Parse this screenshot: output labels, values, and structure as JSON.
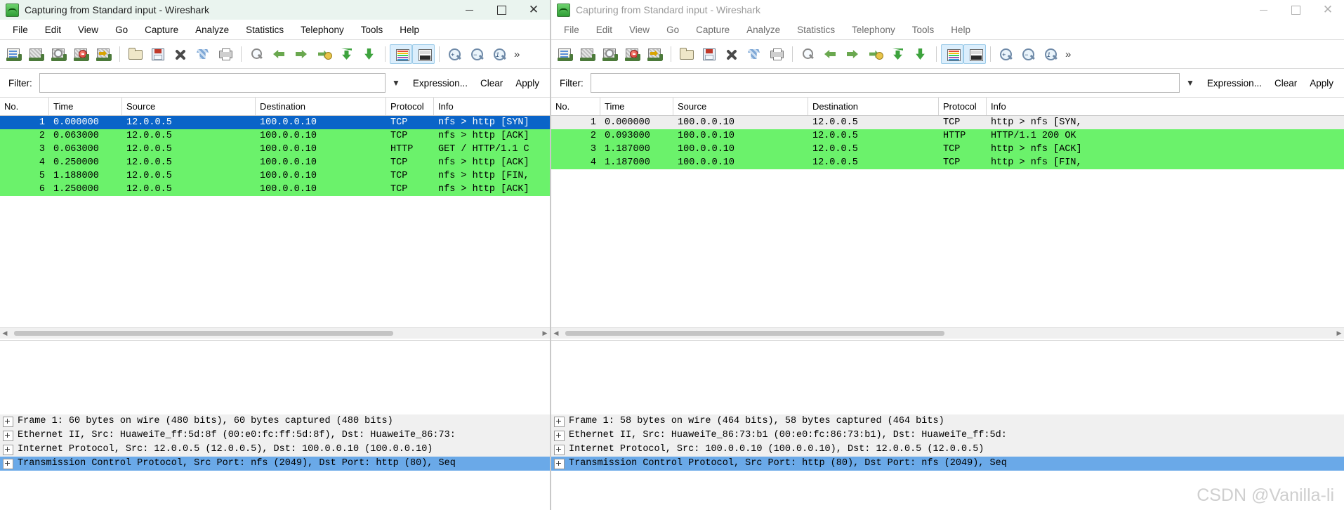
{
  "windows": [
    {
      "id": "left",
      "title": "Capturing from Standard input - Wireshark",
      "active": true,
      "window_buttons": {
        "minimize": "—",
        "maximize": "□",
        "close": "✕"
      },
      "menu": [
        "File",
        "Edit",
        "View",
        "Go",
        "Capture",
        "Analyze",
        "Statistics",
        "Telephony",
        "Tools",
        "Help"
      ],
      "toolbar_icons": [
        "interfaces-icon",
        "capture-options-icon",
        "start-capture-icon",
        "stop-capture-icon",
        "restart-capture-icon",
        "open-file-icon",
        "save-file-icon",
        "close-file-icon",
        "reload-icon",
        "print-icon",
        "find-packet-icon",
        "go-back-icon",
        "go-forward-icon",
        "go-to-packet-icon",
        "go-first-packet-icon",
        "go-last-packet-icon",
        "colorize-icon",
        "auto-scroll-icon",
        "zoom-in-icon",
        "zoom-out-icon",
        "zoom-reset-icon"
      ],
      "filter": {
        "label": "Filter:",
        "value": "",
        "placeholder": "",
        "dropdown": "▼",
        "expression": "Expression...",
        "clear": "Clear",
        "apply": "Apply"
      },
      "columns": [
        "No.",
        "Time",
        "Source",
        "Destination",
        "Protocol",
        "Info"
      ],
      "packets": [
        {
          "no": "1",
          "time": "0.000000",
          "source": "12.0.0.5",
          "destination": "100.0.0.10",
          "protocol": "TCP",
          "info": "nfs > http [SYN]",
          "state": "selected"
        },
        {
          "no": "2",
          "time": "0.063000",
          "source": "12.0.0.5",
          "destination": "100.0.0.10",
          "protocol": "TCP",
          "info": "nfs > http [ACK]",
          "state": "green"
        },
        {
          "no": "3",
          "time": "0.063000",
          "source": "12.0.0.5",
          "destination": "100.0.0.10",
          "protocol": "HTTP",
          "info": "GET / HTTP/1.1 C",
          "state": "green"
        },
        {
          "no": "4",
          "time": "0.250000",
          "source": "12.0.0.5",
          "destination": "100.0.0.10",
          "protocol": "TCP",
          "info": "nfs > http [ACK]",
          "state": "green"
        },
        {
          "no": "5",
          "time": "1.188000",
          "source": "12.0.0.5",
          "destination": "100.0.0.10",
          "protocol": "TCP",
          "info": "nfs > http [FIN,",
          "state": "green"
        },
        {
          "no": "6",
          "time": "1.250000",
          "source": "12.0.0.5",
          "destination": "100.0.0.10",
          "protocol": "TCP",
          "info": "nfs > http [ACK]",
          "state": "green"
        }
      ],
      "detail_rows": [
        {
          "text": "Frame 1: 60 bytes on wire (480 bits), 60 bytes captured (480 bits)",
          "selected": false
        },
        {
          "text": "Ethernet II, Src: HuaweiTe_ff:5d:8f (00:e0:fc:ff:5d:8f), Dst: HuaweiTe_86:73:",
          "selected": false
        },
        {
          "text": "Internet Protocol, Src: 12.0.0.5 (12.0.0.5), Dst: 100.0.0.10 (100.0.0.10)",
          "selected": false
        },
        {
          "text": "Transmission Control Protocol, Src Port: nfs (2049), Dst Port: http (80), Seq",
          "selected": true
        }
      ]
    },
    {
      "id": "right",
      "title": "Capturing from Standard input - Wireshark",
      "active": false,
      "window_buttons": {
        "minimize": "—",
        "maximize": "□",
        "close": "✕"
      },
      "menu": [
        "File",
        "Edit",
        "View",
        "Go",
        "Capture",
        "Analyze",
        "Statistics",
        "Telephony",
        "Tools",
        "Help"
      ],
      "toolbar_icons": [
        "interfaces-icon",
        "capture-options-icon",
        "start-capture-icon",
        "stop-capture-icon",
        "restart-capture-icon",
        "open-file-icon",
        "save-file-icon",
        "close-file-icon",
        "reload-icon",
        "print-icon",
        "find-packet-icon",
        "go-back-icon",
        "go-forward-icon",
        "go-to-packet-icon",
        "go-first-packet-icon",
        "go-last-packet-icon",
        "colorize-icon",
        "auto-scroll-icon",
        "zoom-in-icon",
        "zoom-out-icon",
        "zoom-reset-icon"
      ],
      "filter": {
        "label": "Filter:",
        "value": "",
        "placeholder": "",
        "dropdown": "▼",
        "expression": "Expression...",
        "clear": "Clear",
        "apply": "Apply"
      },
      "columns": [
        "No.",
        "Time",
        "Source",
        "Destination",
        "Protocol",
        "Info"
      ],
      "packets": [
        {
          "no": "1",
          "time": "0.000000",
          "source": "100.0.0.10",
          "destination": "12.0.0.5",
          "protocol": "TCP",
          "info": "http > nfs [SYN,",
          "state": "selected-inactive"
        },
        {
          "no": "2",
          "time": "0.093000",
          "source": "100.0.0.10",
          "destination": "12.0.0.5",
          "protocol": "HTTP",
          "info": "HTTP/1.1 200 OK",
          "state": "green"
        },
        {
          "no": "3",
          "time": "1.187000",
          "source": "100.0.0.10",
          "destination": "12.0.0.5",
          "protocol": "TCP",
          "info": "http > nfs [ACK]",
          "state": "green"
        },
        {
          "no": "4",
          "time": "1.187000",
          "source": "100.0.0.10",
          "destination": "12.0.0.5",
          "protocol": "TCP",
          "info": "http > nfs [FIN,",
          "state": "green"
        }
      ],
      "detail_rows": [
        {
          "text": "Frame 1: 58 bytes on wire (464 bits), 58 bytes captured (464 bits)",
          "selected": false
        },
        {
          "text": "Ethernet II, Src: HuaweiTe_86:73:b1 (00:e0:fc:86:73:b1), Dst: HuaweiTe_ff:5d:",
          "selected": false
        },
        {
          "text": "Internet Protocol, Src: 100.0.0.10 (100.0.0.10), Dst: 12.0.0.5 (12.0.0.5)",
          "selected": false
        },
        {
          "text": "Transmission Control Protocol, Src Port: http (80), Dst Port: nfs (2049), Seq",
          "selected": true
        }
      ]
    }
  ],
  "watermark": "CSDN @Vanilla-li",
  "colors": {
    "selected_row": "#0a64c8",
    "green_row": "#6bf26b",
    "title_bg": "#eaf4ef",
    "detail_selected": "#6aa9e8"
  }
}
